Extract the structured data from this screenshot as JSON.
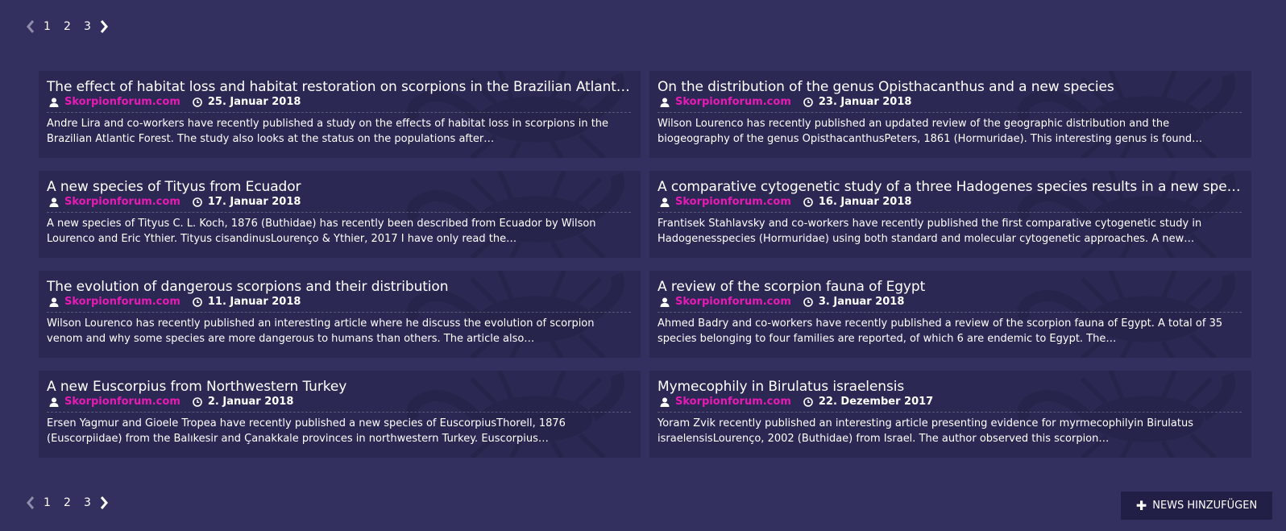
{
  "pagination": {
    "pages": [
      "1",
      "2",
      "3"
    ],
    "prev_icon": "chevron-left-icon",
    "next_icon": "chevron-right-icon"
  },
  "news": [
    {
      "title": "The effect of habitat loss and habitat restoration on scorpions in the Brazilian Atlantic Fo…",
      "source": "Skorpionforum.com",
      "date": "25. Januar 2018",
      "excerpt": "Andre Lira and co-workers have recently published a study on the effects of habitat loss in scorpions in the Brazilian Atlantic Forest. The study also looks at the status on the populations after…"
    },
    {
      "title": "On the distribution of the genus Opisthacanthus and a new species",
      "source": "Skorpionforum.com",
      "date": "23. Januar 2018",
      "excerpt": "Wilson Lourenco has recently published an updated review of the geographic distribution and the biogeography of the genus OpisthacanthusPeters, 1861 (Hormuridae). This interesting genus is found…"
    },
    {
      "title": "A new species of Tityus from Ecuador",
      "source": "Skorpionforum.com",
      "date": "17. Januar 2018",
      "excerpt": "A new species of Tityus C. L. Koch, 1876 (Buthidae) has recently been described from Ecuador by Wilson Lourenco and Eric Ythier. Tityus cisandinusLourenço & Ythier, 2017 I have only read the…"
    },
    {
      "title": "A comparative cytogenetic study of a three Hadogenes species results in a new species …",
      "source": "Skorpionforum.com",
      "date": "16. Januar 2018",
      "excerpt": "Frantisek Stahlavsky and co-workers have recently published the first comparative cytogenetic study in Hadogenesspecies (Hormuridae) using both standard and molecular cytogenetic approaches. A new…"
    },
    {
      "title": "The evolution of dangerous scorpions and their distribution",
      "source": "Skorpionforum.com",
      "date": "11. Januar 2018",
      "excerpt": "Wilson Lourenco has recently published an interesting article where he discuss the evolution of scorpion venom and why some species are more dangerous to humans than others. The article also…"
    },
    {
      "title": "A review of the scorpion fauna of Egypt",
      "source": "Skorpionforum.com",
      "date": "3. Januar 2018",
      "excerpt": "Ahmed Badry and co-workers have recently published a review of the scorpion fauna of Egypt. A total of 35 species belonging to four families are reported, of which 6 are endemic to Egypt. The…"
    },
    {
      "title": "A new Euscorpius from Northwestern Turkey",
      "source": "Skorpionforum.com",
      "date": "2. Januar 2018",
      "excerpt": "Ersen Yagmur and Gioele Tropea have recently published a new species of EuscorpiusThorell, 1876 (Euscorpiidae) from the Balıkesir and Çanakkale provinces in northwestern Turkey. Euscorpius…"
    },
    {
      "title": "Mymecophily in Birulatus israelensis",
      "source": "Skorpionforum.com",
      "date": "22. Dezember 2017",
      "excerpt": "Yoram Zvik recently published an interesting article presenting evidence for myrmecophilyin Birulatus israelensisLourenço, 2002 (Buthidae) from Israel. The author observed this scorpion…"
    }
  ],
  "add_button": {
    "label": "NEWS HINZUFÜGEN",
    "icon": "plus-icon"
  },
  "colors": {
    "background": "#33305f",
    "card": "#2b2953",
    "source_link": "#e61ab4",
    "button": "#221f47"
  }
}
